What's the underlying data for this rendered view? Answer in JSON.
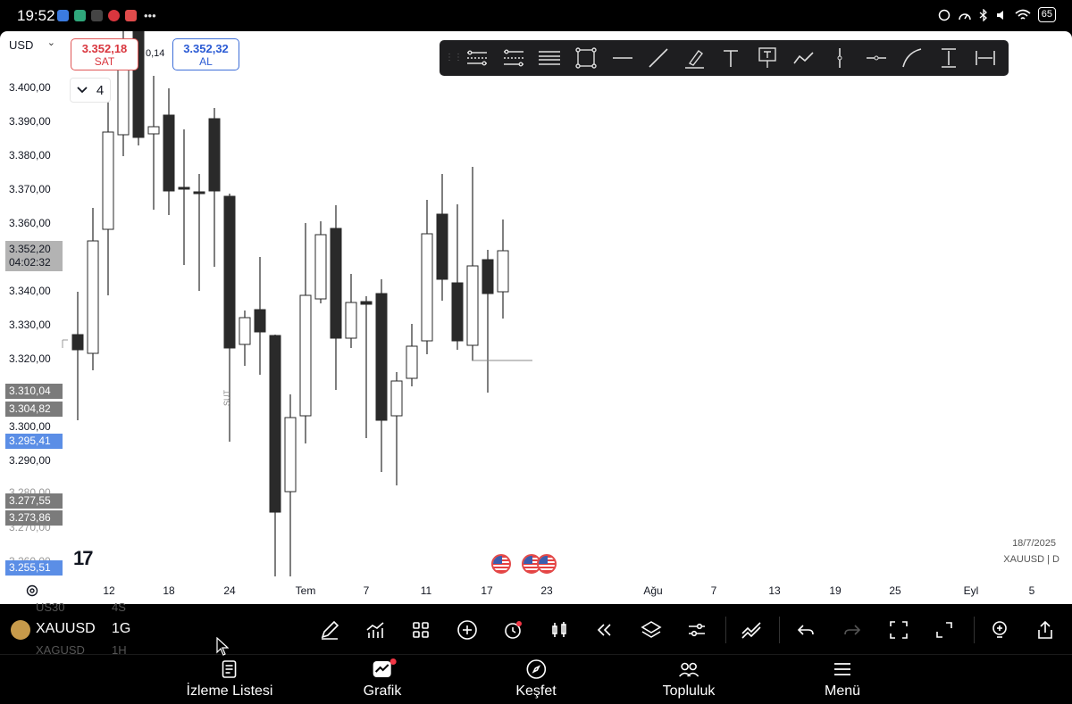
{
  "status_bar": {
    "time": "19:52",
    "battery": "65",
    "app_icons": [
      "#3b7be0",
      "#2fa77b",
      "#444444",
      "#d9363e",
      "#e04b4b"
    ]
  },
  "chart": {
    "currency": "USD",
    "sell": {
      "price": "3.352,18",
      "label": "SAT"
    },
    "buy": {
      "price": "3.352,32",
      "label": "AL"
    },
    "spread": "0,14",
    "collapse_count": "4",
    "price_axis_labels": [
      "3.400,00",
      "3.390,00",
      "3.380,00",
      "3.370,00",
      "3.360,00",
      "3.340,00",
      "3.330,00",
      "3.320,00",
      "3.300,00",
      "3.290,00",
      "3.280,00",
      "3.270,00",
      "3.260,00"
    ],
    "current_price": {
      "price": "3.352,20",
      "countdown": "04:02:32"
    },
    "price_badges": [
      {
        "value": "3.310,04",
        "color": "gray"
      },
      {
        "value": "3.304,82",
        "color": "gray"
      },
      {
        "value": "3.295,41",
        "color": "blue"
      },
      {
        "value": "3.277,55",
        "color": "gray"
      },
      {
        "value": "3.273,86",
        "color": "gray"
      },
      {
        "value": "3.255,51",
        "color": "blue"
      }
    ],
    "time_axis_labels": [
      "12",
      "18",
      "24",
      "Tem",
      "7",
      "11",
      "17",
      "23",
      "Ağu",
      "7",
      "13",
      "19",
      "25",
      "Eyl",
      "5"
    ],
    "date_stamp": "18/7/2025",
    "symbol_stamp": "XAUUSD | D",
    "logo_text": "17",
    "session_marker": "SUT",
    "candle_color_up": "#ffffff",
    "candle_color_down": "#2a2a2a",
    "drawing_tools": [
      "parallel-channel-icon",
      "regression-trend-icon",
      "horizontal-lines-icon",
      "rectangle-icon",
      "horizontal-line-icon",
      "trend-line-icon",
      "brush-icon",
      "text-icon",
      "anchored-text-icon",
      "path-icon",
      "vertical-line-icon",
      "horizontal-ray-icon",
      "curve-icon",
      "price-range-icon",
      "date-range-icon"
    ]
  },
  "symbol_bar": {
    "symbol": "XAUUSD",
    "interval": "1G",
    "ghost_above": {
      "symbol": "US30",
      "interval": "4S"
    },
    "ghost_below": {
      "symbol": "XAGUSD",
      "interval": "1H"
    },
    "actions": [
      "pencil-icon",
      "indicators-icon",
      "layouts-icon",
      "add-icon",
      "alert-icon",
      "chart-type-icon",
      "replay-icon",
      "layers-icon",
      "settings-icon",
      "trading-icon",
      "undo-icon",
      "redo-icon",
      "fullscreen-frame-icon",
      "expand-icon",
      "idea-icon",
      "share-icon"
    ]
  },
  "tabs": [
    {
      "label": "İzleme Listesi",
      "icon": "watchlist-icon"
    },
    {
      "label": "Grafik",
      "icon": "chart-icon"
    },
    {
      "label": "Keşfet",
      "icon": "compass-icon"
    },
    {
      "label": "Topluluk",
      "icon": "community-icon"
    },
    {
      "label": "Menü",
      "icon": "menu-icon"
    }
  ]
}
